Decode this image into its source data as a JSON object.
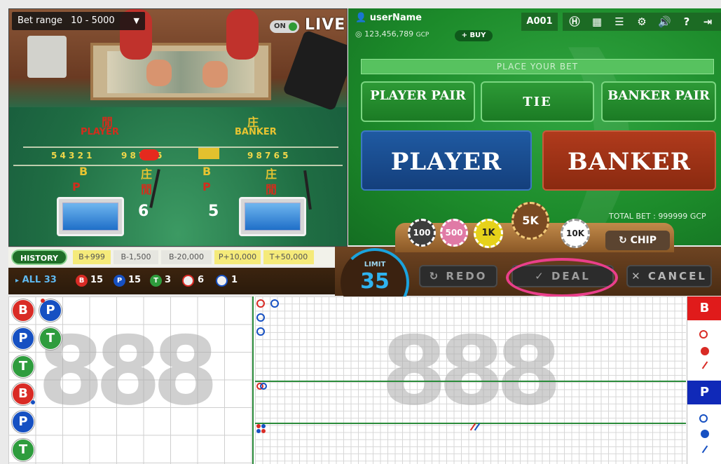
{
  "video": {
    "bet_range_label": "Bet range",
    "bet_range_value": "10 - 5000",
    "live_toggle": "ON",
    "live_label": "LIVE",
    "table": {
      "player_cn": "閒",
      "player_label": "PLAYER",
      "banker_cn": "庄",
      "banker_label": "BANKER",
      "numbers_left": "5 4 3 2 1",
      "numbers_mid": "9 8 7 6 5",
      "numbers_right": "9 8 7 6 5",
      "card_left": "6",
      "card_right": "5"
    }
  },
  "header": {
    "username": "userName",
    "balance": "123,456,789",
    "currency": "GCP",
    "buy_label": "+ BUY",
    "table_id": "A001",
    "icons": [
      "history-icon",
      "grid-icon",
      "list-icon",
      "gear-icon",
      "sound-icon",
      "help-icon",
      "exit-icon"
    ]
  },
  "betting": {
    "prompt": "PLACE YOUR BET",
    "player_pair": "PLAYER PAIR",
    "tie": "TIE",
    "banker_pair": "BANKER PAIR",
    "player": "PLAYER",
    "banker": "BANKER",
    "total_bet_label": "TOTAL BET :",
    "total_bet_value": "999999",
    "total_bet_currency": "GCP"
  },
  "chips": {
    "values": [
      "100",
      "500",
      "1K",
      "5K",
      "10K"
    ],
    "selected": "5K",
    "chip_button": "CHIP"
  },
  "limit": {
    "label": "LIMIT",
    "value": "35"
  },
  "actions": {
    "redo": "REDO",
    "deal": "DEAL",
    "cancel": "CANCEL"
  },
  "history": {
    "tab_label": "HISTORY",
    "items": [
      "B+999",
      "B-1,500",
      "B-20,000",
      "P+10,000",
      "T+50,000"
    ]
  },
  "stats": {
    "all_label": "ALL",
    "all_count": "33",
    "banker_count": "15",
    "player_count": "15",
    "tie_count": "3",
    "banker_pair_count": "6",
    "player_pair_count": "1",
    "letters": {
      "banker": "B",
      "player": "P",
      "tie": "T"
    }
  },
  "roadmap": {
    "bead_col1": [
      "B",
      "P",
      "T",
      "B",
      "P",
      "T"
    ],
    "bead_col2": [
      "P",
      "T"
    ],
    "watermark": "888",
    "legend": {
      "banker": "B",
      "player": "P"
    }
  },
  "colors": {
    "banker": "#d92b25",
    "player": "#1650c2",
    "tie": "#2e9c3d",
    "accent_ring": "#ea3f8b",
    "limit": "#2fb3ef"
  }
}
